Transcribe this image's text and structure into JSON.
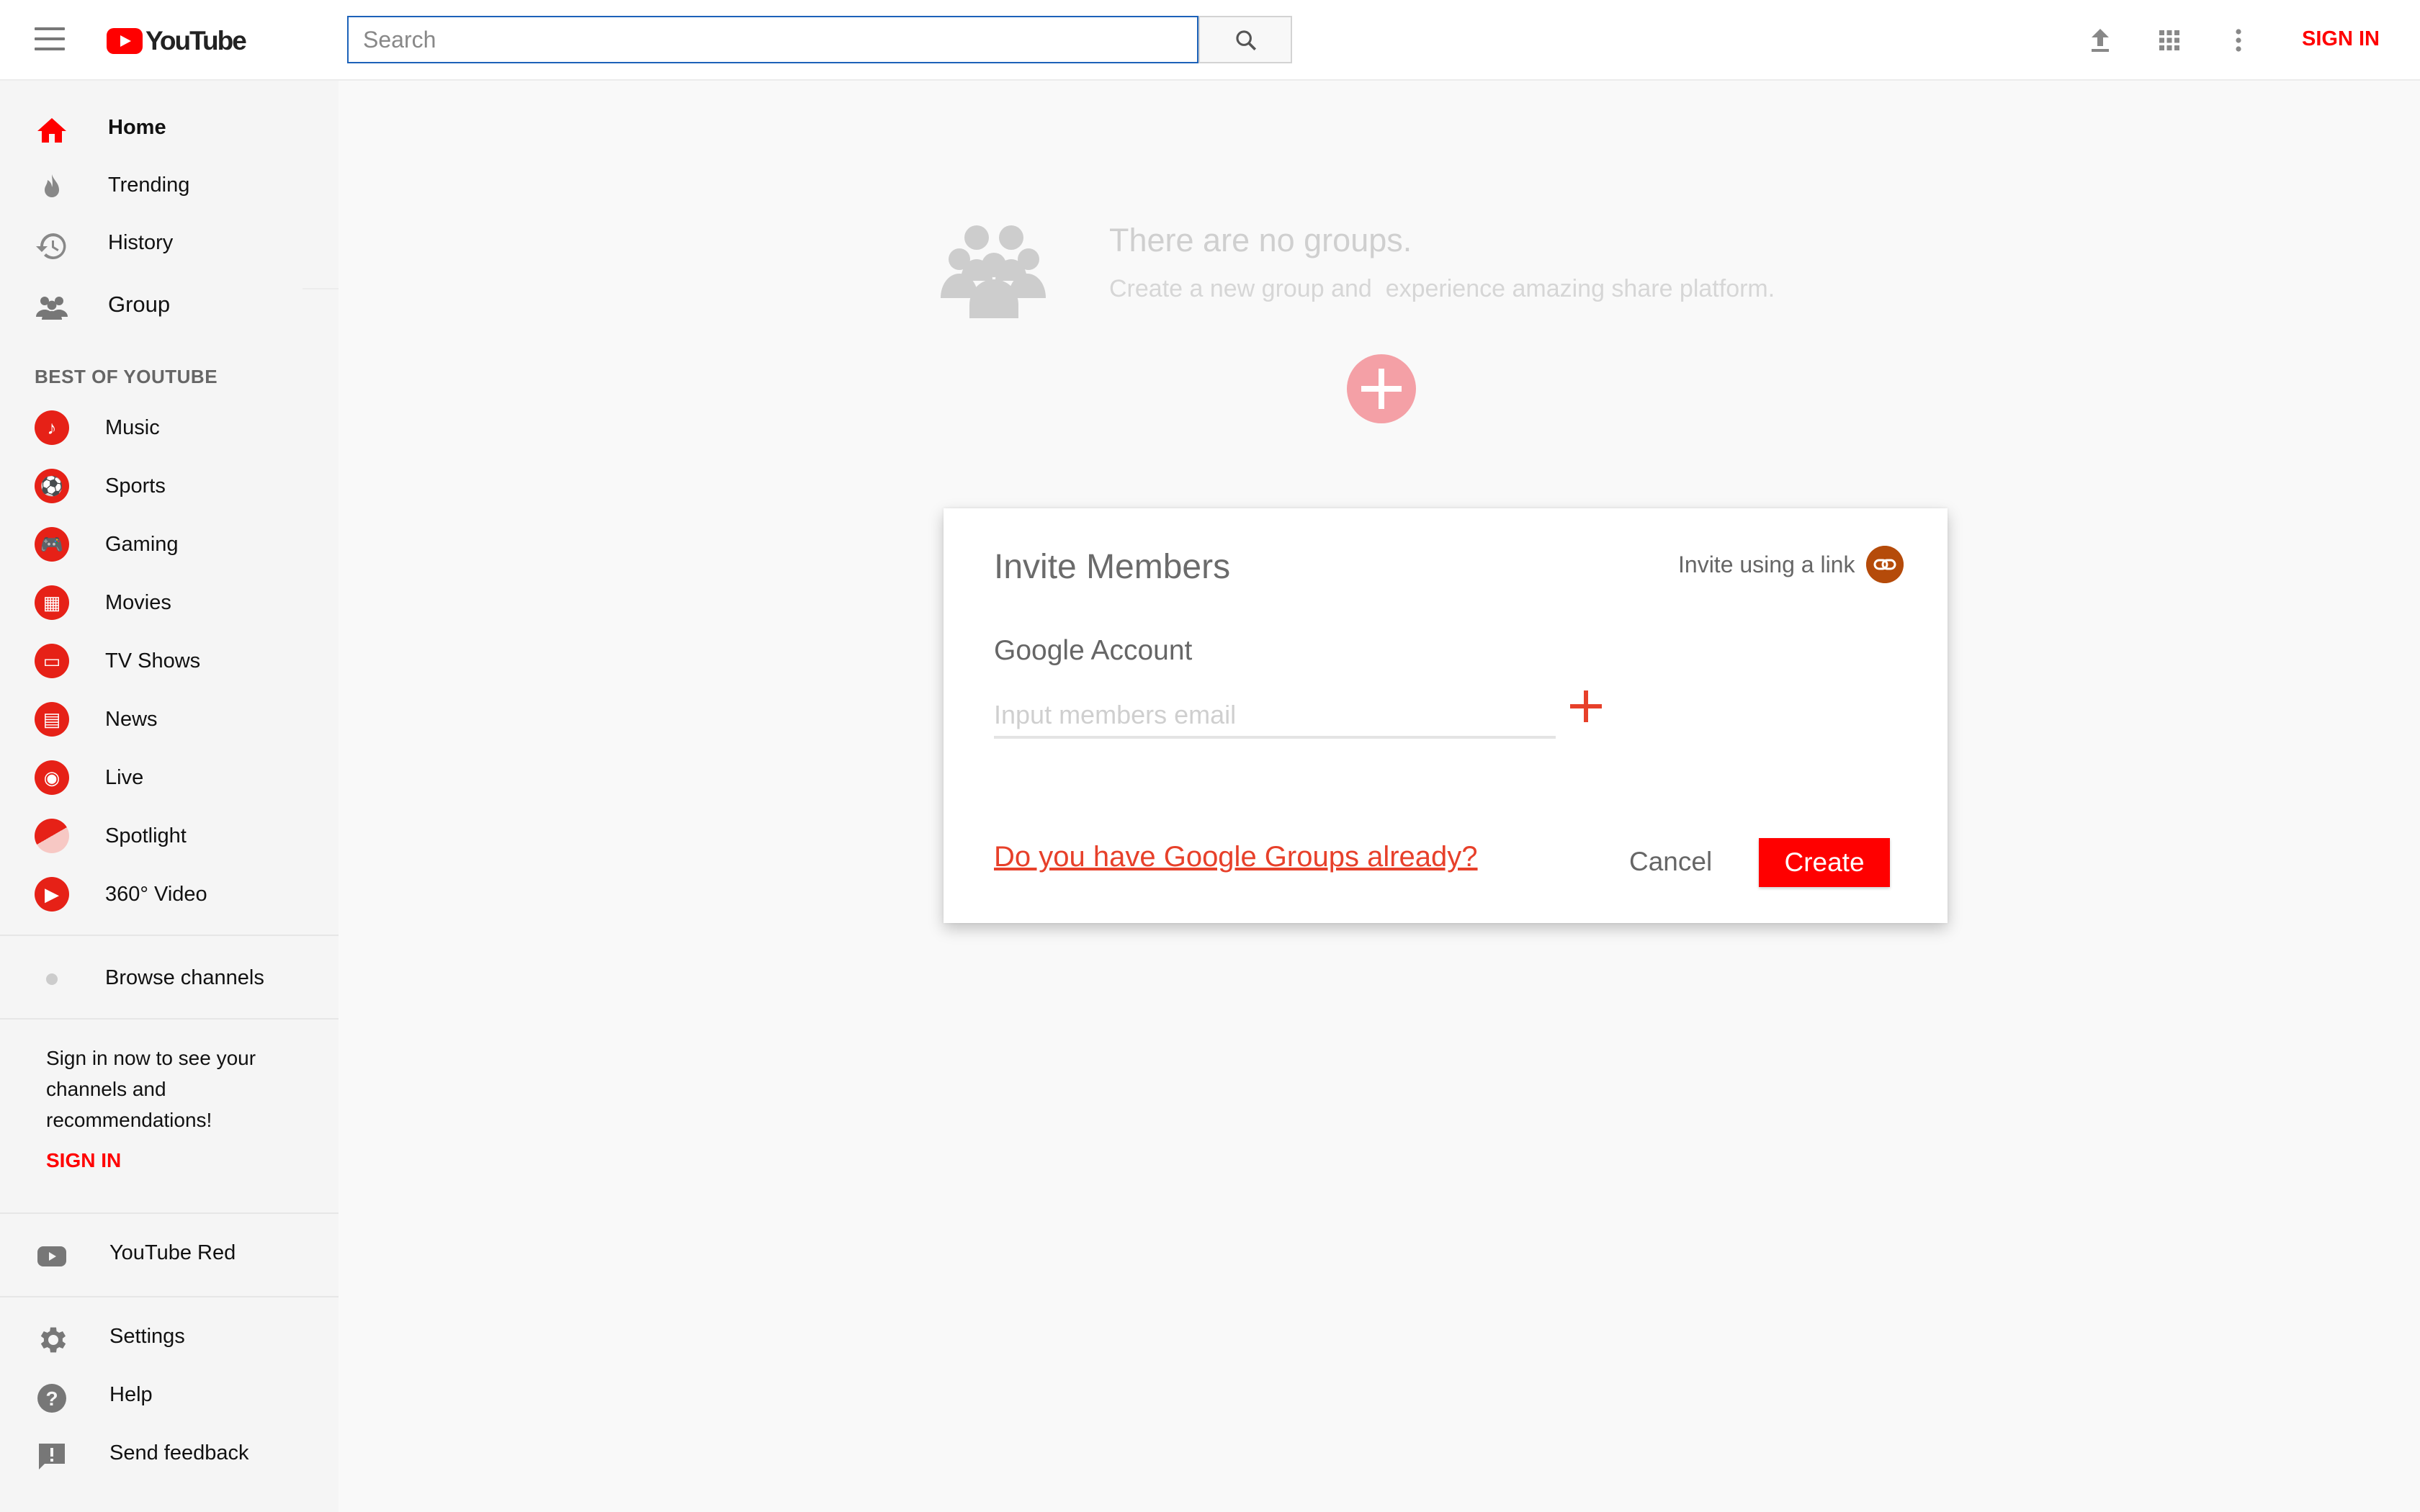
{
  "header": {
    "logo_text": "YouTube",
    "search_placeholder": "Search",
    "sign_in": "SIGN IN"
  },
  "sidebar": {
    "nav": [
      {
        "label": "Home",
        "icon": "home-icon"
      },
      {
        "label": "Trending",
        "icon": "flame-icon"
      },
      {
        "label": "History",
        "icon": "history-icon"
      },
      {
        "label": "Group",
        "icon": "group-icon"
      }
    ],
    "section_title": "BEST OF YOUTUBE",
    "categories": [
      {
        "label": "Music",
        "icon": "music-icon"
      },
      {
        "label": "Sports",
        "icon": "sports-icon"
      },
      {
        "label": "Gaming",
        "icon": "gaming-icon"
      },
      {
        "label": "Movies",
        "icon": "movies-icon"
      },
      {
        "label": "TV Shows",
        "icon": "tv-icon"
      },
      {
        "label": "News",
        "icon": "news-icon"
      },
      {
        "label": "Live",
        "icon": "live-icon"
      },
      {
        "label": "Spotlight",
        "icon": "spotlight-icon"
      },
      {
        "label": "360° Video",
        "icon": "360-video-icon"
      }
    ],
    "browse_channels": "Browse channels",
    "signin_note": "Sign in now to see your channels and recommendations!",
    "signin_link": "SIGN IN",
    "youtube_red": "YouTube Red",
    "footer": [
      {
        "label": "Settings",
        "icon": "gear-icon"
      },
      {
        "label": "Help",
        "icon": "help-icon"
      },
      {
        "label": "Send feedback",
        "icon": "feedback-icon"
      }
    ]
  },
  "main": {
    "empty_title": "There are no groups.",
    "empty_subtitle": "Create a new group and  experience amazing share platform."
  },
  "dialog": {
    "title": "Invite Members",
    "invite_link": "Invite using a link",
    "field_label": "Google Account",
    "email_placeholder": "Input members email",
    "groups_link": "Do you have Google Groups already?",
    "cancel": "Cancel",
    "create": "Create"
  },
  "colors": {
    "accent": "#ff0000",
    "link": "#e7402a",
    "category_icon": "#e62117",
    "add_circle": "#f4a0a6",
    "search_border": "#1c62b9"
  }
}
